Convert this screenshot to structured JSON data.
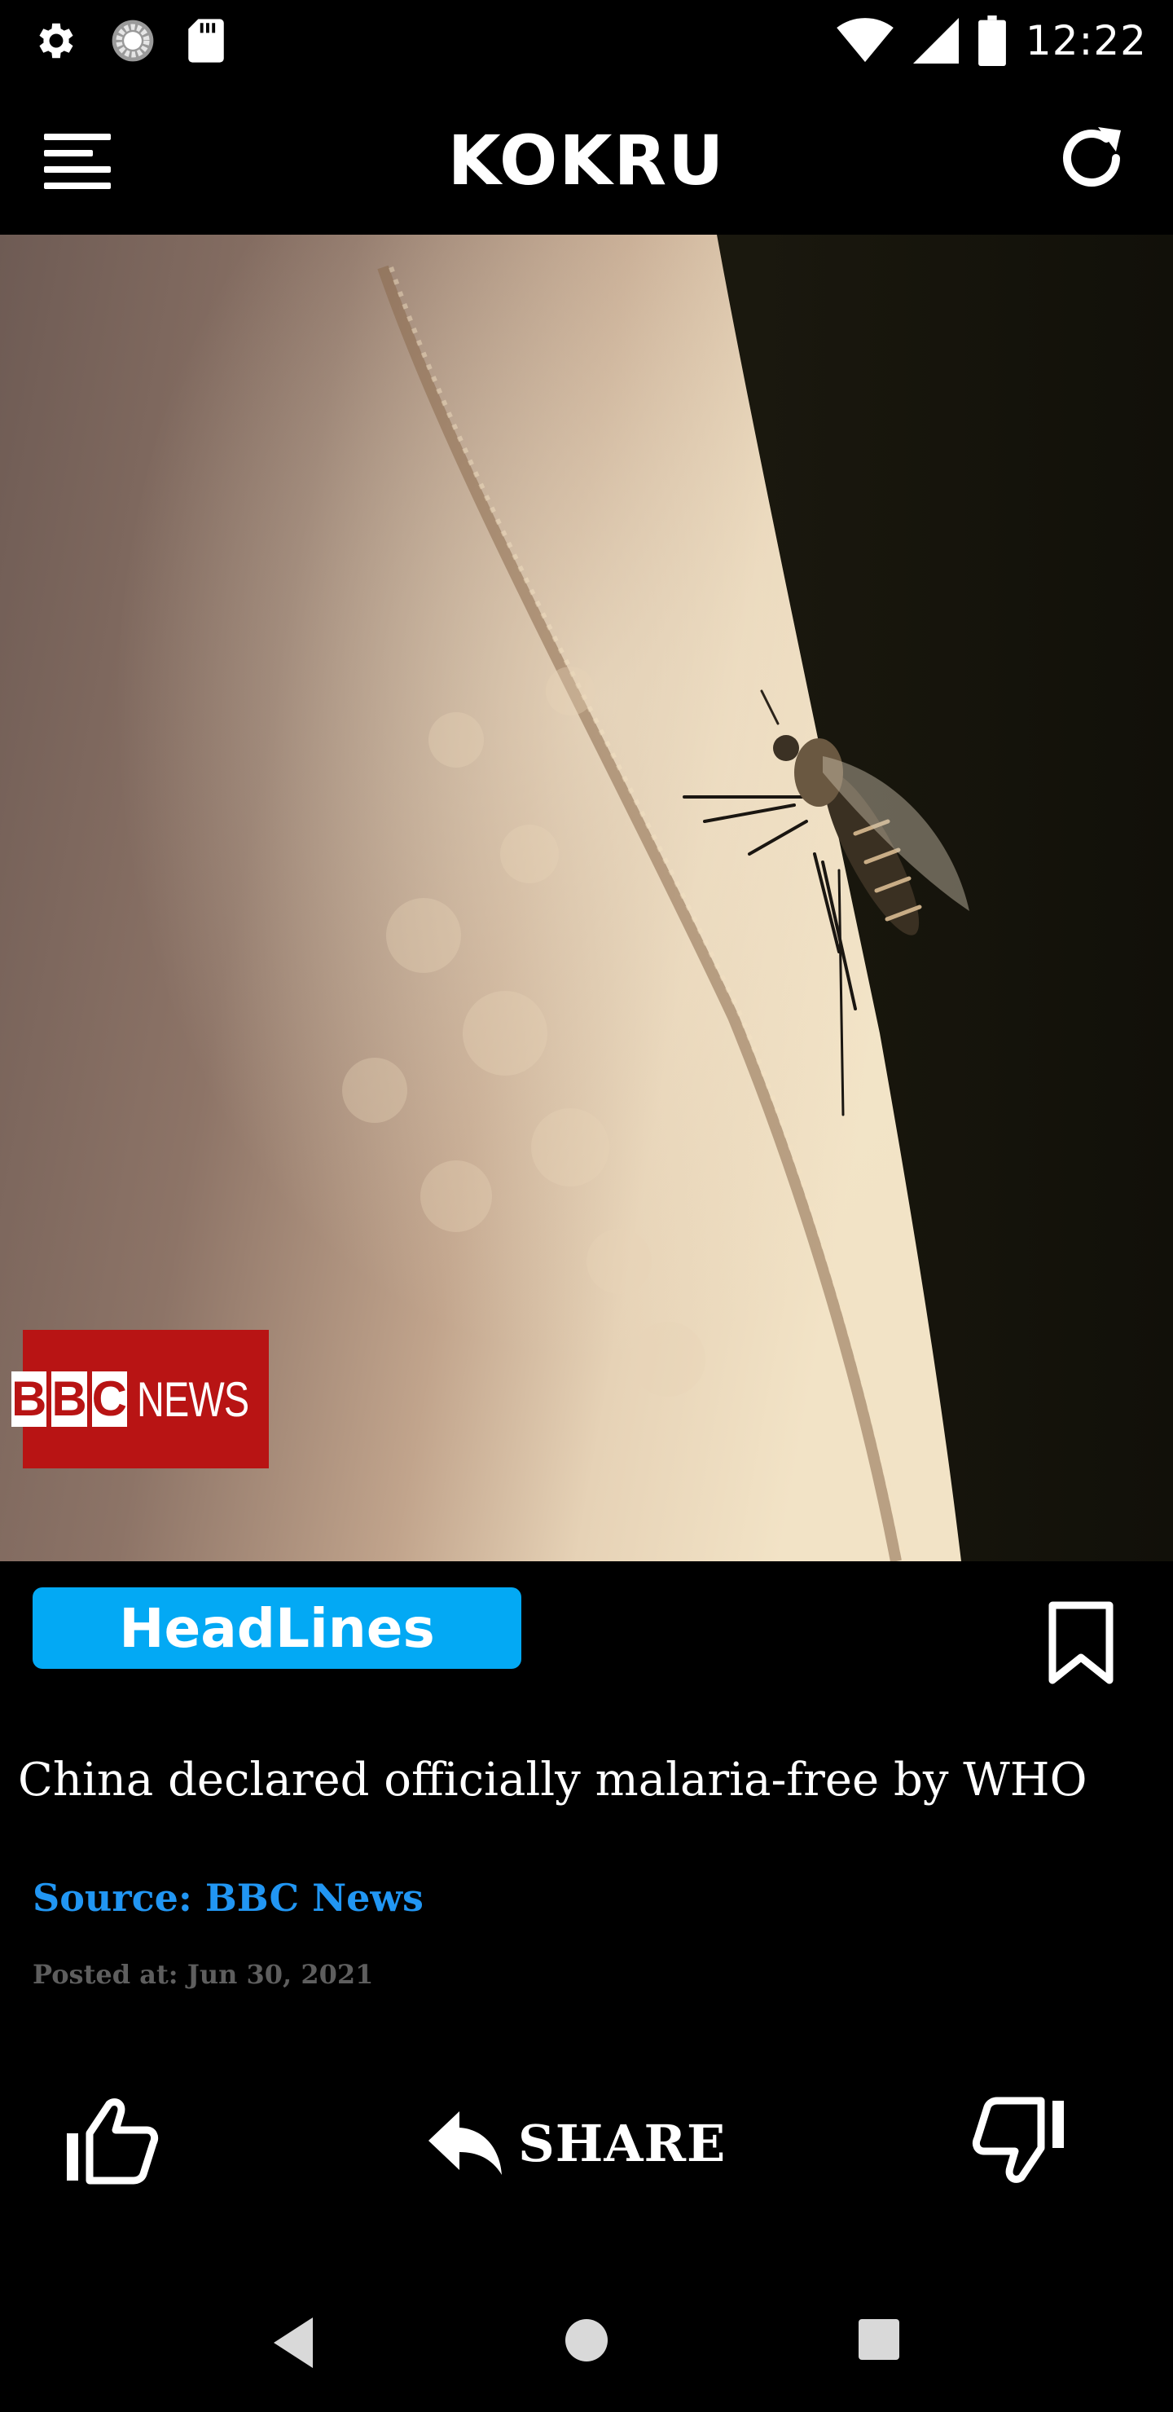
{
  "status_bar": {
    "time": "12:22",
    "icons": [
      "gear-icon",
      "sync-circle-icon",
      "sd-card-icon",
      "wifi-icon",
      "signal-icon",
      "battery-icon"
    ]
  },
  "app_bar": {
    "title": "KOKRU",
    "menu_icon": "menu-icon",
    "refresh_icon": "refresh-icon"
  },
  "article": {
    "image_logo": {
      "letters": [
        "B",
        "B",
        "C"
      ],
      "suffix": "NEWS"
    },
    "category": "HeadLines",
    "bookmark_icon": "bookmark-icon",
    "headline": "China declared officially malaria-free by WHO",
    "source": "Source: BBC News",
    "posted": "Posted at: Jun 30, 2021"
  },
  "actions": {
    "like_icon": "thumbs-up-icon",
    "share_label": "SHARE",
    "share_icon": "reply-icon",
    "dislike_icon": "thumbs-down-icon"
  },
  "nav_bar": {
    "icons": [
      "back-icon",
      "home-icon",
      "recents-icon"
    ]
  },
  "colors": {
    "background": "#000000",
    "accent": "#03a9f4",
    "source_link": "#2196f3",
    "muted_text": "#5e5e5e",
    "bbc_red": "#b81414"
  }
}
